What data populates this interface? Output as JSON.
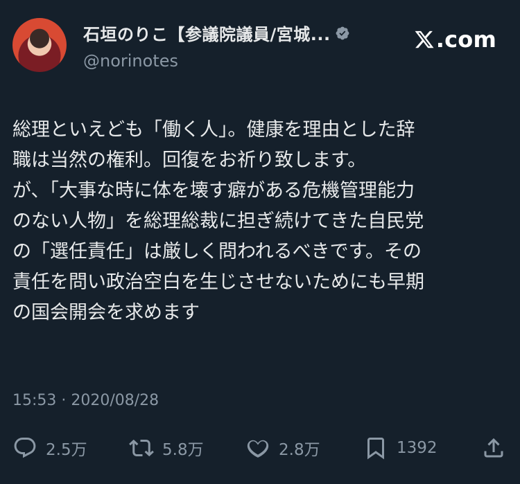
{
  "author": {
    "display_name": "石垣のりこ【参議院議員/宮城...",
    "handle": "@norinotes",
    "verified_icon": "verified-badge-icon",
    "avatar_icon": "profile-avatar"
  },
  "brand": {
    "label": ".com",
    "logo_icon": "x-logo-icon"
  },
  "tweet": {
    "text": "総理といえども「働く人」。健康を理由とした辞\n職は当然の権利。回復をお祈り致します。\nが、「大事な時に体を壊す癖がある危機管理能力\nのない人物」を総理総裁に担ぎ続けてきた自民党\nの「選任責任」は厳しく問われるべきです。その\n責任を問い政治空白を生じさせないためにも早期\nの国会開会を求めます"
  },
  "meta": {
    "timestamp": "15:53 · 2020/08/28"
  },
  "actions": {
    "reply": {
      "icon": "reply-icon",
      "count": "2.5万"
    },
    "retweet": {
      "icon": "retweet-icon",
      "count": "5.8万"
    },
    "like": {
      "icon": "heart-icon",
      "count": "2.8万"
    },
    "bookmark": {
      "icon": "bookmark-icon",
      "count": "1392"
    },
    "share": {
      "icon": "share-icon"
    }
  },
  "colors": {
    "background": "#15202b",
    "text": "#e7e9ea",
    "muted": "#8b98a5",
    "verified": "#8b98a5"
  }
}
